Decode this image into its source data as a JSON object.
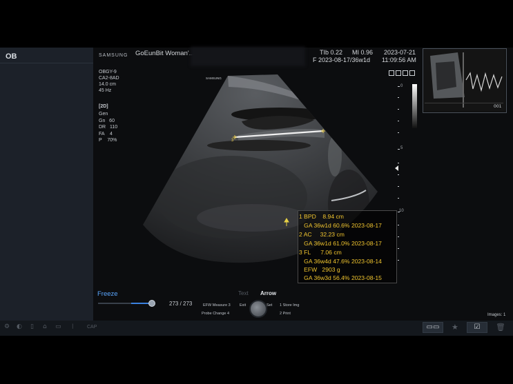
{
  "left_panel": {
    "mode": "OB"
  },
  "header": {
    "brand": "SAMSUNG",
    "patient": "GoEunBit Woman'...",
    "tib": "TIb  0.22",
    "mi": "MI   0.96",
    "date": "2023-07-21",
    "lmp_ga": "F  2023-08-17/36w1d",
    "time": "11:09:56 AM"
  },
  "params": {
    "preset": "OBGY-9",
    "probe": "CA2-8AD",
    "depth": "14.0 cm",
    "rate": "45 Hz",
    "mode": "[2D]",
    "lines": [
      "Gen",
      "Gn   60",
      "DR   110",
      "FA    4",
      "P    70%"
    ]
  },
  "scale_ticks": [
    "0",
    "5",
    "10"
  ],
  "image_watermark": "SAMSUNG",
  "measurements": [
    {
      "label": "1 BPD    8.94 cm"
    },
    {
      "label": "   GA 36w1d 60.6% 2023-08-17"
    },
    {
      "label": "2 AC     32.23 cm"
    },
    {
      "label": "   GA 36w1d 61.0% 2023-08-17"
    },
    {
      "label": "3 FL      7.06 cm"
    },
    {
      "label": "   GA 36w4d 47.6% 2023-08-14"
    },
    {
      "label": "   EFW   2903 g"
    },
    {
      "label": "   GA 36w3d 56.4% 2023-08-15"
    }
  ],
  "thumbnail": {
    "number": "001"
  },
  "controls": {
    "freeze": "Freeze",
    "frame_count": "273 / 273",
    "text": "Text",
    "arrow": "Arrow",
    "efw_measure": "EFW Measure 3",
    "probe_change": "Probe Change 4",
    "exit": "Exit",
    "set": "Set",
    "store_img": "1 Store Img",
    "print": "2 Print",
    "images": "Images: 1",
    "cap": "CAP"
  },
  "colors": {
    "accent": "#3b82e0",
    "measure": "#f0c42e",
    "caliper": "#e8c840"
  }
}
